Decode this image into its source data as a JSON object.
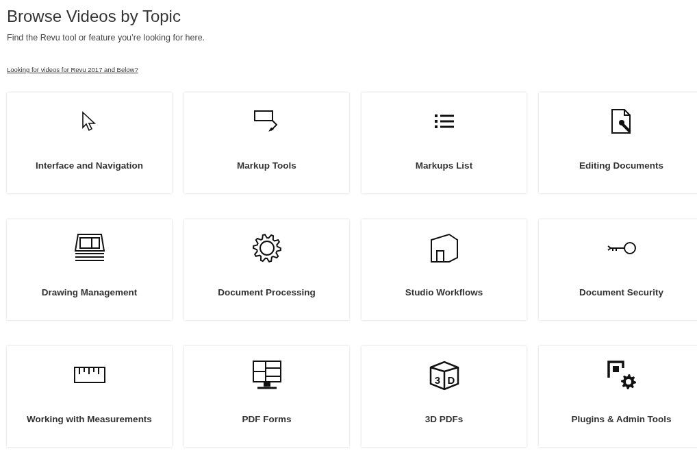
{
  "heading": "Browse Videos by Topic",
  "subheading": "Find the Revu tool or feature you’re looking for here.",
  "link": "Looking for videos for Revu 2017 and Below?",
  "topics": [
    {
      "label": "Interface and Navigation"
    },
    {
      "label": "Markup Tools"
    },
    {
      "label": "Markups List"
    },
    {
      "label": "Editing Documents"
    },
    {
      "label": "Drawing Management"
    },
    {
      "label": "Document Processing"
    },
    {
      "label": "Studio Workflows"
    },
    {
      "label": "Document Security"
    },
    {
      "label": "Working with Measurements"
    },
    {
      "label": "PDF Forms"
    },
    {
      "label": "3D PDFs",
      "icon_letters": [
        "3",
        "D"
      ]
    },
    {
      "label": "Plugins & Admin Tools"
    }
  ]
}
